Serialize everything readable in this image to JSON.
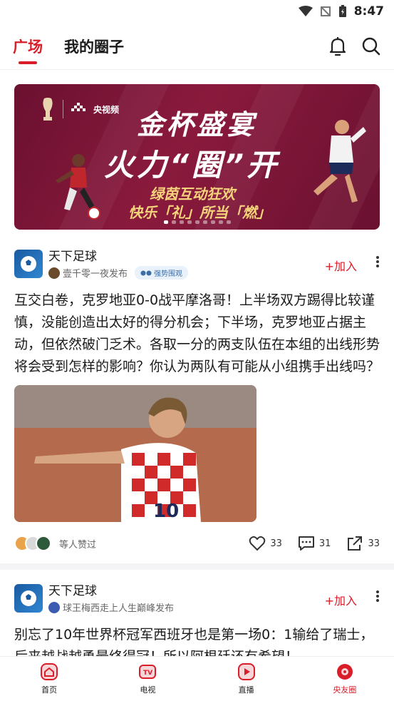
{
  "status_bar": {
    "time": "8:47"
  },
  "top_nav": {
    "tabs": [
      {
        "label": "广场",
        "active": true
      },
      {
        "label": "我的圈子",
        "active": false
      }
    ],
    "icons": [
      "bell-icon",
      "search-icon"
    ]
  },
  "banner": {
    "logo_text": "央视频",
    "title_line1": "金杯盛宴",
    "title_line2": "火力“圈”开",
    "subtitle_line1": "绿茵互动狂欢",
    "subtitle_line2": "快乐「礼」所当「燃」",
    "dot_count": 9,
    "active_dot": 0
  },
  "posts": [
    {
      "circle_name": "天下足球",
      "avatar_text": "天下足球",
      "author": "壹千零一夜发布",
      "badge": "强势围观",
      "join_label": "+加入",
      "text": "互交白卷，克罗地亚0-0战平摩洛哥！上半场双方踢得比较谨慎，没能创造出太好的得分机会；下半场，克罗地亚占据主动，但依然破门乏术。各取一分的两支队伍在本组的出线形势将会受到怎样的影响？你认为两队有可能从小组携手出线吗？",
      "liked_text": "等人赞过",
      "likes": "33",
      "comments": "31",
      "shares": "33"
    },
    {
      "circle_name": "天下足球",
      "avatar_text": "天下足球",
      "author": "球王梅西走上人生巅峰发布",
      "join_label": "+加入",
      "text": "别忘了10年世界杯冠军西班牙也是第一场0：1输给了瑞士，后来越战越勇最终得冠！所以阿根廷还有希望！"
    }
  ],
  "bottom_nav": {
    "items": [
      {
        "label": "首页",
        "active": false
      },
      {
        "label": "电视",
        "active": false
      },
      {
        "label": "直播",
        "active": false
      },
      {
        "label": "央友圈",
        "active": true
      }
    ]
  },
  "colors": {
    "accent": "#d91e2a",
    "banner_bg": "#7a1535"
  }
}
